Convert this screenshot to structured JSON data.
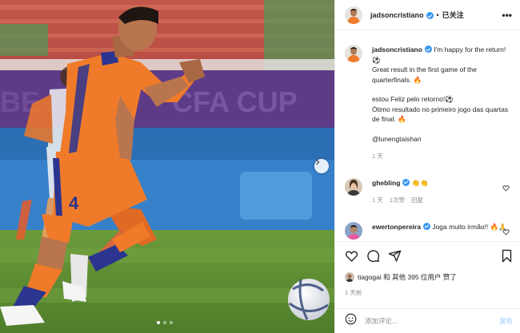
{
  "post": {
    "username": "jadsoncristiano",
    "follow_state": "已关注",
    "more_label": "•••",
    "separator": "•",
    "caption_lines_en": [
      "I'm happy for the return! ⚽",
      "Great result in the first game of the quarterfinals. 🔥"
    ],
    "caption_lines_pt": [
      "estou Feliz pelo retorno!⚽",
      "Ótimo resultado no primeiro jogo das quartas de final. 🔥"
    ],
    "mention": "@lunengtaishan",
    "caption_time": "1 天"
  },
  "comments": [
    {
      "username": "ghebling",
      "text": "👏👏",
      "time": "1 天",
      "likes": "1次赞",
      "reply_label": "回复"
    },
    {
      "username": "ewertonpereira",
      "text": "Joga muito irmão!! 🔥🙏"
    }
  ],
  "likes": {
    "text": "tiagogai 和 其他 395 位用户 赞了"
  },
  "timestamp": "1 天前",
  "add_comment": {
    "placeholder": "添加评论...",
    "post_label": "发布"
  },
  "photo": {
    "banner_text": "CFA CUP",
    "jersey_number": "4",
    "pager": {
      "count": 3,
      "active": 1
    }
  },
  "colors": {
    "accent_blue": "#3897f0",
    "post_button": "#b3dbff",
    "jersey_orange": "#ef7b2a",
    "stripe_navy": "#2b3590"
  },
  "icons": [
    "next-arrow-icon",
    "verified-icon",
    "heart-icon",
    "comment-icon",
    "share-icon",
    "bookmark-icon",
    "emoji-icon"
  ]
}
